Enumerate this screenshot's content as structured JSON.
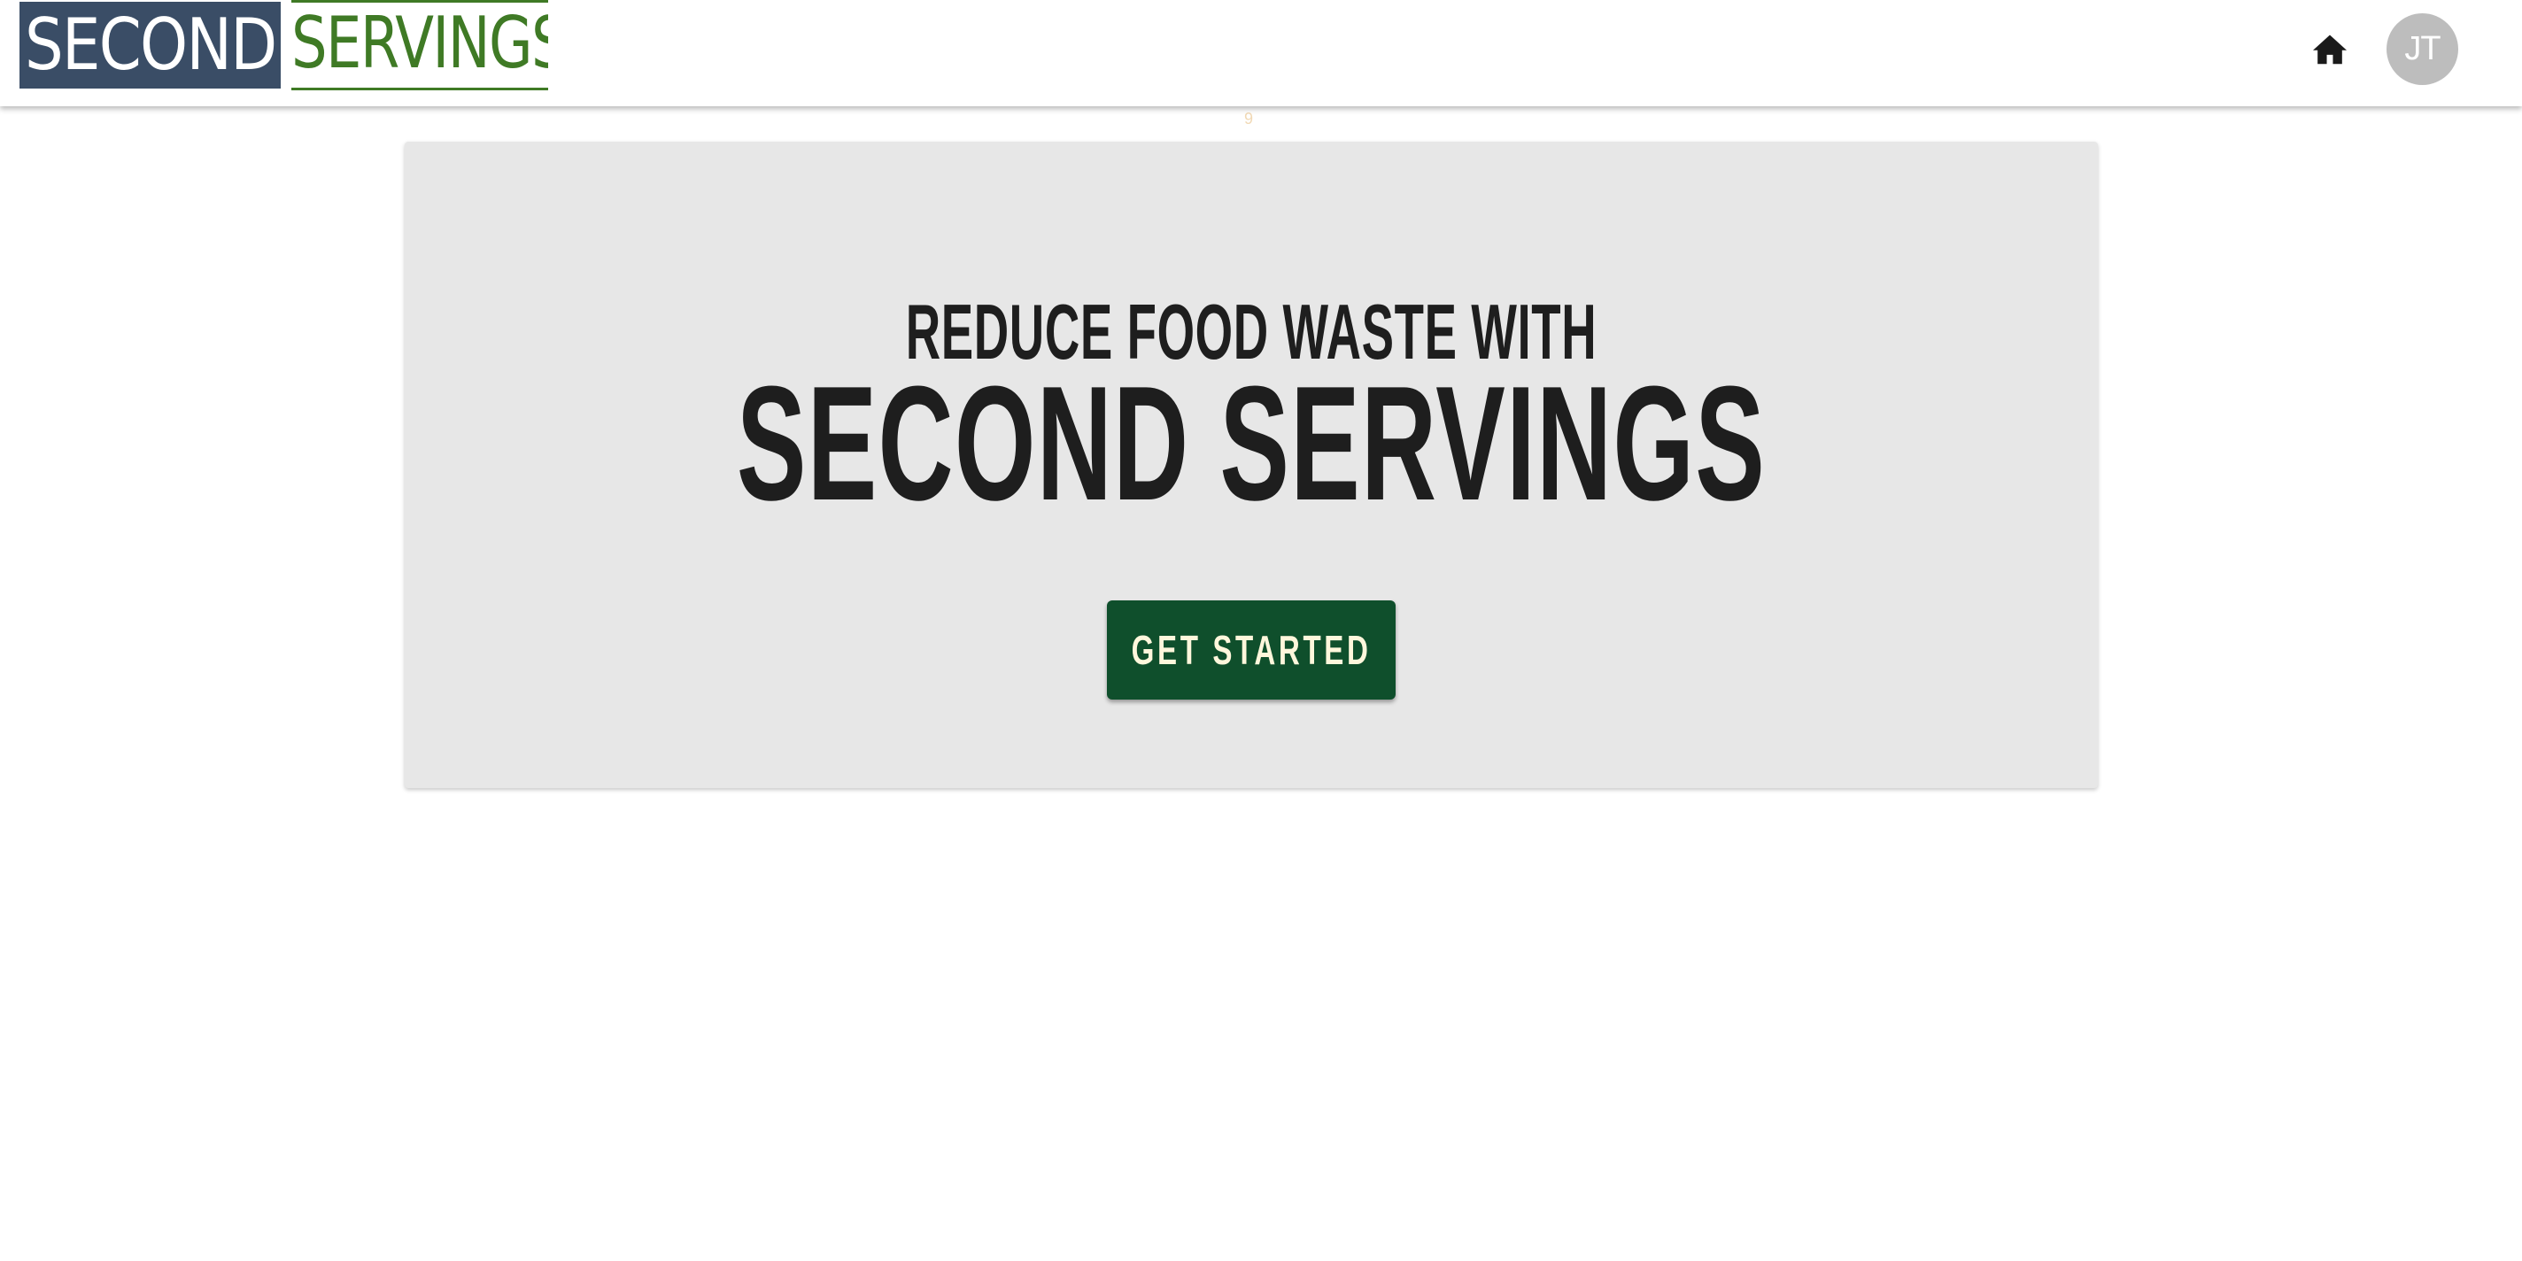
{
  "header": {
    "logo": {
      "part1": "SECOND",
      "part2": "SERVINGS",
      "colors": {
        "part1_bg": "#3a4d66",
        "part2_text": "#3f7a25"
      }
    },
    "home_icon": "home-icon",
    "avatar": {
      "initials": "JT",
      "color": "#bdbdbd"
    }
  },
  "stray_mark": "9",
  "hero": {
    "subtitle": "REDUCE FOOD WASTE WITH",
    "title": "SECOND SERVINGS",
    "cta_label": "GET STARTED",
    "colors": {
      "panel_bg": "#e7e7e7",
      "cta_bg": "#0f4f2c",
      "cta_text": "#fff7dc"
    }
  }
}
